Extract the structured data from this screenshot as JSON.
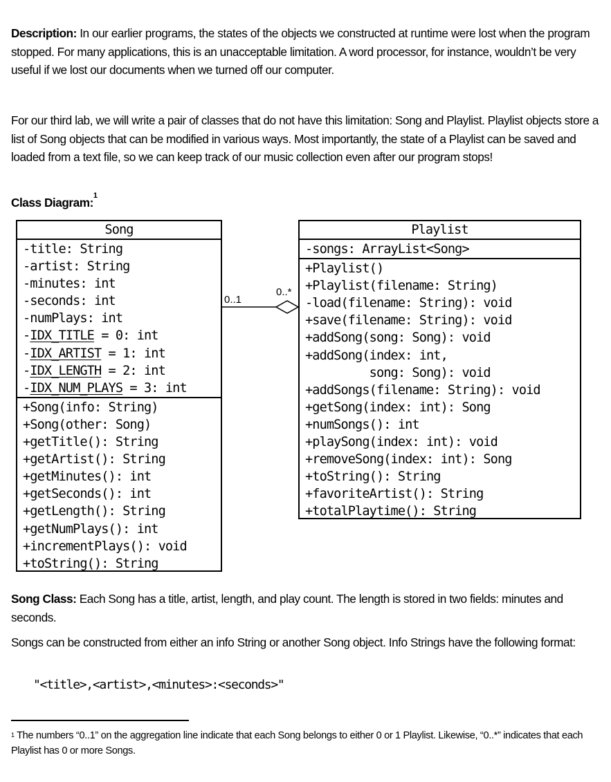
{
  "description": {
    "label": "Description:",
    "text": " In our earlier programs, the states of the objects we constructed at runtime were lost when the program stopped. For many applications, this is an unacceptable limitation. A word processor, for instance, wouldn’t be very useful if we lost our documents when we turned off our computer."
  },
  "intro": {
    "text": "For our third lab, we will write a pair of classes that do not have this limitation: Song and Playlist. Playlist objects store a list of Song objects that can be modified in various ways. Most importantly, the state of a Playlist can be saved and loaded from a text file, so we can keep track of our music collection even after our program stops!"
  },
  "class_diagram": {
    "heading": "Class Diagram:",
    "footnote_ref": "1",
    "song": {
      "name": "Song",
      "fields": [
        {
          "prefix": "-",
          "name": "title: String",
          "static": false
        },
        {
          "prefix": "-",
          "name": "artist: String",
          "static": false
        },
        {
          "prefix": "-",
          "name": "minutes: int",
          "static": false
        },
        {
          "prefix": "-",
          "name": "seconds: int",
          "static": false
        },
        {
          "prefix": "-",
          "name": "numPlays: int",
          "static": false
        },
        {
          "prefix": "-",
          "name": "IDX_TITLE",
          "rest": " = 0: int",
          "static": true
        },
        {
          "prefix": "-",
          "name": "IDX_ARTIST",
          "rest": " = 1: int",
          "static": true
        },
        {
          "prefix": "-",
          "name": "IDX_LENGTH",
          "rest": " = 2: int",
          "static": true
        },
        {
          "prefix": "-",
          "name": "IDX_NUM_PLAYS",
          "rest": " = 3: int",
          "static": true
        }
      ],
      "methods": [
        "+Song(info: String)",
        "+Song(other: Song)",
        "+getTitle(): String",
        "+getArtist(): String",
        "+getMinutes(): int",
        "+getSeconds(): int",
        "+getLength(): String",
        "+getNumPlays(): int",
        "+incrementPlays(): void",
        "+toString(): String"
      ]
    },
    "playlist": {
      "name": "Playlist",
      "fields": [
        "-songs: ArrayList<Song>"
      ],
      "methods": [
        "+Playlist()",
        "+Playlist(filename: String)",
        "-load(filename: String): void",
        "+save(filename: String): void",
        "+addSong(song: Song): void",
        "+addSong(index: int,",
        "         song: Song): void",
        "+addSongs(filename: String): void",
        "+getSong(index: int): Song",
        "+numSongs(): int",
        "+playSong(index: int): void",
        "+removeSong(index: int): Song",
        "+toString(): String",
        "+favoriteArtist(): String",
        "+totalPlaytime(): String"
      ]
    },
    "association": {
      "type": "aggregation",
      "song_multiplicity": "0..1",
      "playlist_multiplicity": "0..*"
    }
  },
  "song_class": {
    "label": "Song Class:",
    "text": " Each Song has a title, artist, length, and play count. The length is stored in two fields: minutes and seconds.",
    "construct_text": "Songs can be constructed from either an info String or another Song object. Info Strings have the following format:",
    "format": "\"<title>,<artist>,<minutes>:<seconds>\""
  },
  "footnote": {
    "number": "1",
    "text": " The numbers “0..1” on the aggregation line indicate that each Song belongs to either 0 or 1 Playlist. Likewise, “0..*” indicates that each Playlist has 0 or more Songs."
  }
}
